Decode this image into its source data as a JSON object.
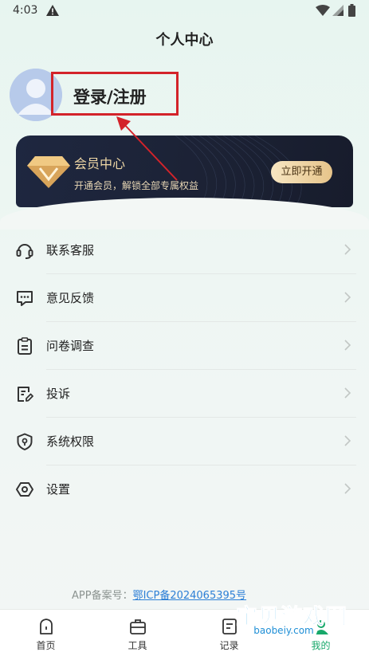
{
  "status_bar": {
    "time": "4:03"
  },
  "header": {
    "title": "个人中心"
  },
  "profile": {
    "login_label": "登录/注册"
  },
  "vip": {
    "title": "会员中心",
    "subtitle": "开通会员，解锁全部专属权益",
    "button": "立即开通",
    "accent": "#f0d8a6",
    "background": "#1e2740"
  },
  "menu": {
    "items": [
      {
        "label": "联系客服",
        "icon": "headset-icon"
      },
      {
        "label": "意见反馈",
        "icon": "chat-bubble-icon"
      },
      {
        "label": "问卷调查",
        "icon": "clipboard-icon"
      },
      {
        "label": "投诉",
        "icon": "edit-document-icon"
      },
      {
        "label": "系统权限",
        "icon": "shield-icon"
      },
      {
        "label": "设置",
        "icon": "settings-icon"
      }
    ]
  },
  "footer": {
    "icp_prefix": "APP备案号：",
    "icp_number": "鄂ICP备2024065395号"
  },
  "watermark": {
    "text": "宝贝游戏网",
    "url": "baobeiy.com"
  },
  "tabbar": {
    "tabs": [
      {
        "label": "首页",
        "icon": "home-icon"
      },
      {
        "label": "工具",
        "icon": "toolbox-icon"
      },
      {
        "label": "记录",
        "icon": "record-icon"
      },
      {
        "label": "我的",
        "icon": "profile-icon",
        "active": true
      }
    ],
    "active_color": "#17a86a"
  }
}
